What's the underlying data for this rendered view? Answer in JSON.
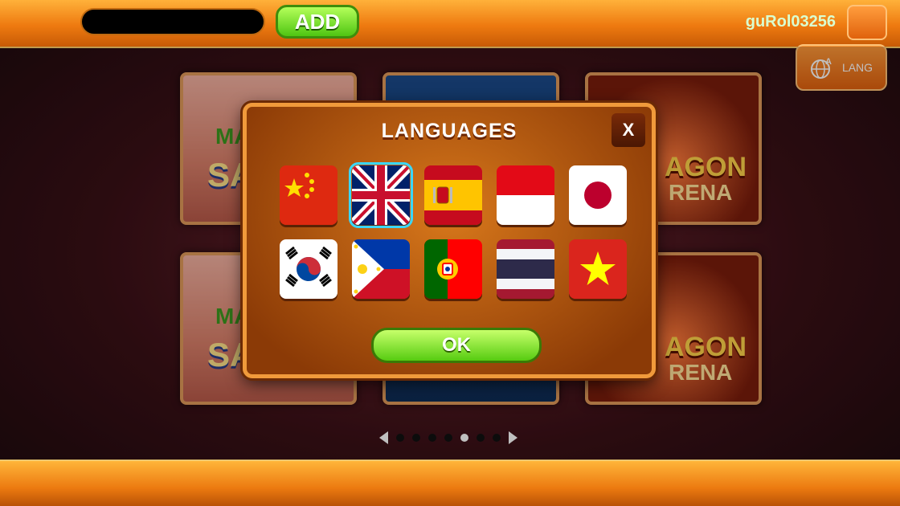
{
  "header": {
    "add_label": "ADD",
    "username": "guRol03256"
  },
  "lang_button": {
    "label": "LANG",
    "icon": "globe-icon"
  },
  "games": [
    {
      "name": "mahjong",
      "text_a": "MA",
      "text_b": "SA"
    },
    {
      "name": "tiles"
    },
    {
      "name": "dragon",
      "text_a": "AGON",
      "text_b": "RENA"
    }
  ],
  "pager": {
    "pages": 7,
    "active": 5
  },
  "dialog": {
    "title": "LANGUAGES",
    "close_label": "X",
    "ok_label": "OK",
    "languages": [
      {
        "code": "zh",
        "flag": "china-flag-icon"
      },
      {
        "code": "en",
        "flag": "uk-flag-icon",
        "selected": true
      },
      {
        "code": "es",
        "flag": "spain-flag-icon"
      },
      {
        "code": "id",
        "flag": "indonesia-flag-icon"
      },
      {
        "code": "ja",
        "flag": "japan-flag-icon"
      },
      {
        "code": "ko",
        "flag": "korea-flag-icon"
      },
      {
        "code": "fil",
        "flag": "philippines-flag-icon"
      },
      {
        "code": "pt",
        "flag": "portugal-flag-icon"
      },
      {
        "code": "th",
        "flag": "thailand-flag-icon"
      },
      {
        "code": "vi",
        "flag": "vietnam-flag-icon"
      }
    ]
  },
  "colors": {
    "accent_orange": "#ee7a10",
    "button_green": "#57cc11",
    "selection": "#39d7ff"
  }
}
